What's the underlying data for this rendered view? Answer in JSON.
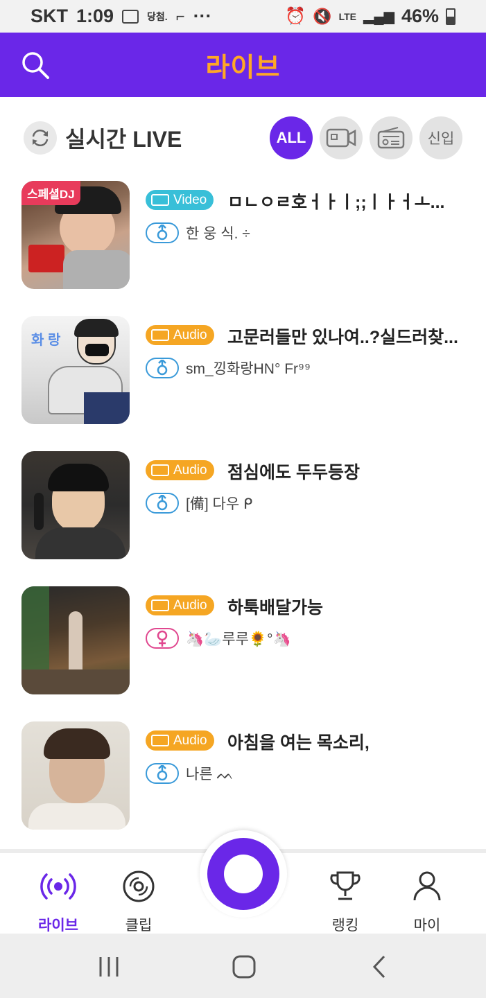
{
  "status_bar": {
    "carrier": "SKT",
    "time": "1:09",
    "notif_text": "당첨.",
    "more": "···",
    "lte": "LTE",
    "battery": "46%"
  },
  "header": {
    "title": "라이브"
  },
  "section": {
    "title": "실시간 LIVE",
    "filters": [
      "ALL",
      "",
      "",
      "신입"
    ]
  },
  "streams": [
    {
      "badge": "스페셜DJ",
      "type": "Video",
      "title": "ㅁㄴㅇㄹ호ㅓㅏㅣ;;ㅣㅏㅓㅗ...",
      "host": "한 웅 식.        ÷",
      "gender": "male",
      "thumb_colors": [
        "#5b3a2a",
        "#c9a28a",
        "#a7a7a7"
      ]
    },
    {
      "overlay": "화 랑",
      "type": "Audio",
      "title": "고문러들만 있나여..?실드러찾...",
      "host": "sm_낑화랑HN° Fr⁹⁹",
      "gender": "male",
      "thumb_colors": [
        "#eeeeee",
        "#c8c8c8",
        "#2a3a6a"
      ]
    },
    {
      "type": "Audio",
      "title": "점심에도 두두등장",
      "host": "[備] 다우 ᑭ",
      "gender": "male",
      "thumb_colors": [
        "#2c2c2c",
        "#6a5a4a",
        "#d9b99a"
      ]
    },
    {
      "type": "Audio",
      "title": "하툭배달가능",
      "host": "🦄🦢루루🌻°🦄",
      "gender": "female",
      "thumb_colors": [
        "#2a2a2a",
        "#7a5a3a",
        "#3a6a3a"
      ]
    },
    {
      "type": "Audio",
      "title": "아침을 여는 목소리,",
      "host": "나른    ᨓ",
      "gender": "male",
      "thumb_colors": [
        "#d8d2c8",
        "#b89a82",
        "#4a3a2a"
      ]
    }
  ],
  "bottom_nav": {
    "live": "라이브",
    "clip": "클립",
    "ranking": "랭킹",
    "my": "마이"
  },
  "colors": {
    "brand": "#6a27e8",
    "accent": "#ffa726",
    "video_tag": "#38bfd8",
    "audio_tag": "#f5a623",
    "male": "#3a9ad9",
    "female": "#e0478f"
  }
}
